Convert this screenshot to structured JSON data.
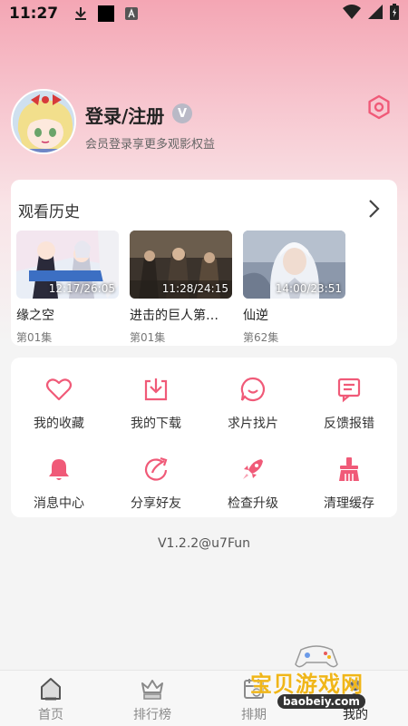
{
  "status_bar": {
    "time": "11:27"
  },
  "profile": {
    "login_title": "登录/注册",
    "vip_badge": "V",
    "subtitle": "会员登录享更多观影权益"
  },
  "history": {
    "title": "观看历史",
    "items": [
      {
        "title": "缘之空",
        "episode": "第01集",
        "time": "12:17/26:05"
      },
      {
        "title": "进击的巨人第…",
        "episode": "第01集",
        "time": "11:28/24:15"
      },
      {
        "title": "仙逆",
        "episode": "第62集",
        "time": "14:00/23:51"
      }
    ]
  },
  "menu": [
    {
      "label": "我的收藏",
      "icon": "heart-icon"
    },
    {
      "label": "我的下载",
      "icon": "download-icon"
    },
    {
      "label": "求片找片",
      "icon": "chat-bubble-icon"
    },
    {
      "label": "反馈报错",
      "icon": "feedback-icon"
    },
    {
      "label": "消息中心",
      "icon": "bell-icon"
    },
    {
      "label": "分享好友",
      "icon": "share-icon"
    },
    {
      "label": "检查升级",
      "icon": "rocket-icon"
    },
    {
      "label": "清理缓存",
      "icon": "broom-icon"
    }
  ],
  "version": "V1.2.2@u7Fun",
  "nav": [
    {
      "label": "首页",
      "icon": "home-icon"
    },
    {
      "label": "排行榜",
      "icon": "ranking-icon"
    },
    {
      "label": "排期",
      "icon": "calendar-icon"
    },
    {
      "label": "我的",
      "icon": "user-icon"
    }
  ],
  "watermark": {
    "text": "宝贝游戏网",
    "url": "baobeiy.com"
  },
  "colors": {
    "accent": "#f05a78",
    "header_gradient_top": "#f4a6b4",
    "watermark": "#f0b619"
  }
}
